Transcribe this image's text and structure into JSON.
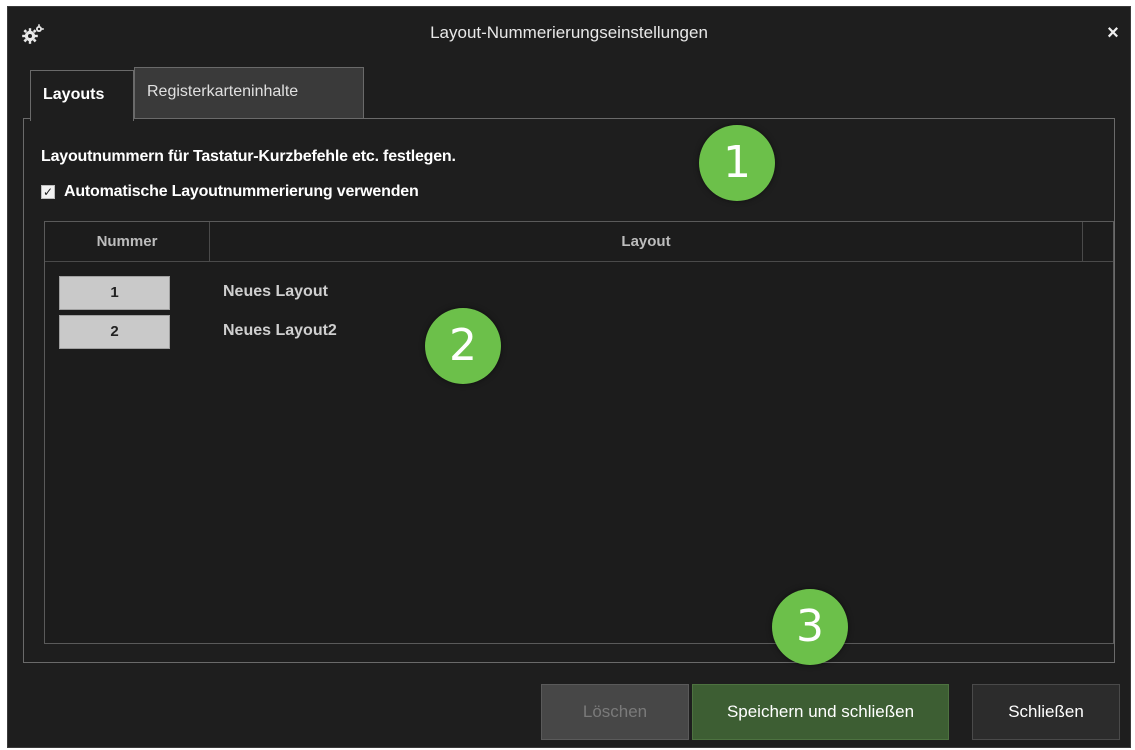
{
  "window": {
    "title": "Layout-Nummerierungseinstellungen",
    "close_symbol": "×",
    "icon": "gears-icon"
  },
  "tabs": [
    {
      "label": "Layouts",
      "active": true
    },
    {
      "label": "Registerkarteninhalte",
      "active": false
    }
  ],
  "panel": {
    "description": "Layoutnummern für Tastatur-Kurzbefehle etc. festlegen.",
    "auto_numbering": {
      "label": "Automatische Layoutnummerierung verwenden",
      "checked": true,
      "check_symbol": "✓"
    }
  },
  "table": {
    "columns": [
      "Nummer",
      "Layout"
    ],
    "rows": [
      {
        "number": "1",
        "name": "Neues Layout"
      },
      {
        "number": "2",
        "name": "Neues Layout2"
      }
    ]
  },
  "badges": [
    "1",
    "2",
    "3"
  ],
  "buttons": {
    "delete": "Löschen",
    "save_close": "Speichern und schließen",
    "close": "Schließen"
  },
  "colors": {
    "background": "#1e1e1e",
    "badge": "#6cc04a",
    "save_button": "#3d5e33"
  }
}
